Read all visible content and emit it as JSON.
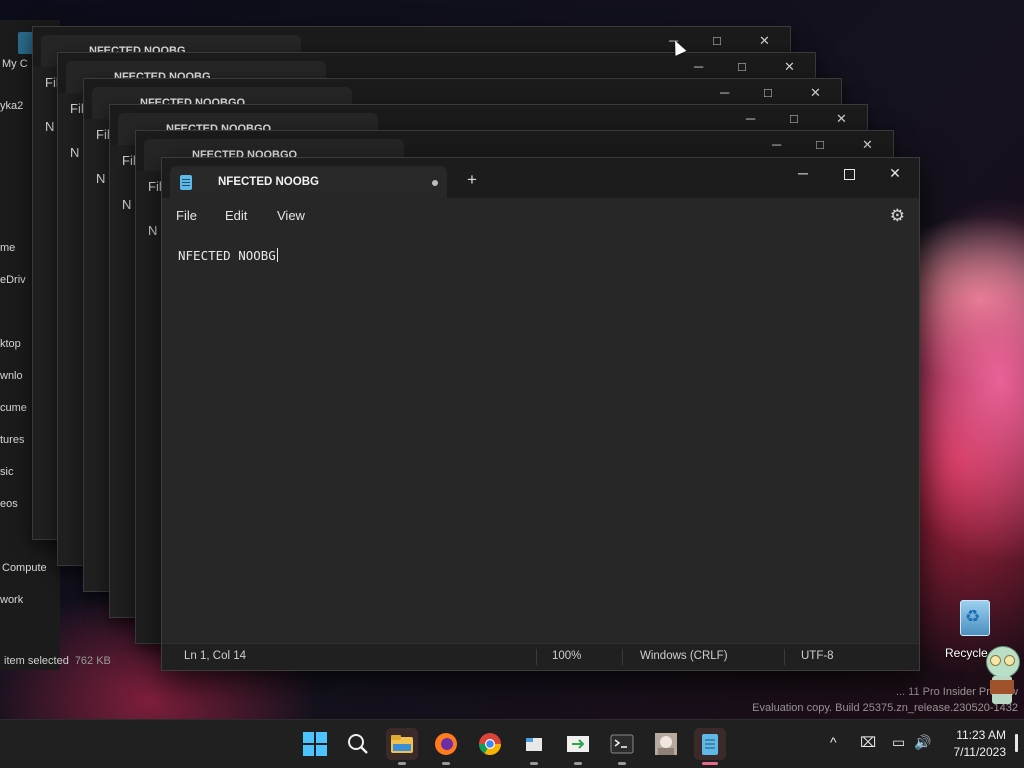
{
  "desktop": {
    "watermark_line1": "... 11 Pro Insider Preview",
    "watermark_line2": "Evaluation copy. Build 25375.zn_release.230520-1432",
    "recycle_label": "Recycle"
  },
  "explorer_behind": {
    "title_fragment": "My C",
    "user_fragment": "yka2",
    "nav": [
      "me",
      "eDriv",
      "ktop",
      "wnlo",
      "cume",
      "tures",
      "sic",
      "eos",
      "Compute",
      "work"
    ],
    "status_text": "item selected",
    "status_size": "762 KB"
  },
  "background_windows": {
    "titles": [
      "NFECTED NOOBG",
      "NFECTED NOOBG",
      "NFECTED NOOBGO",
      "NFECTED NOOBGO",
      "NFECTED NOOBGO"
    ],
    "menu_fragments": [
      "Fil",
      "Fil",
      "Fil",
      "Fil",
      "Fil"
    ],
    "content_fragments": [
      "N",
      "N",
      "N",
      "N",
      "N"
    ]
  },
  "notepad": {
    "tab_title": "NFECTED NOOBG",
    "new_tab_symbol": "+",
    "menu": {
      "file": "File",
      "edit": "Edit",
      "view": "View"
    },
    "content": "NFECTED NOOBG",
    "status": {
      "position": "Ln 1, Col 14",
      "zoom": "100%",
      "line_ending": "Windows (CRLF)",
      "encoding": "UTF-8"
    },
    "icons": {
      "minimize": "─",
      "maximize": "maximize-icon",
      "close": "✕",
      "settings": "⚙"
    }
  },
  "taskbar": {
    "apps": [
      "start",
      "search",
      "file-explorer",
      "firefox",
      "chrome",
      "file-explorer-2",
      "app-green",
      "terminal",
      "photo",
      "notepad"
    ],
    "tray": {
      "chevron": "^",
      "network": "⌧",
      "display": "▭",
      "volume": "🔊"
    },
    "time": "11:23 AM",
    "date": "7/11/2023"
  }
}
